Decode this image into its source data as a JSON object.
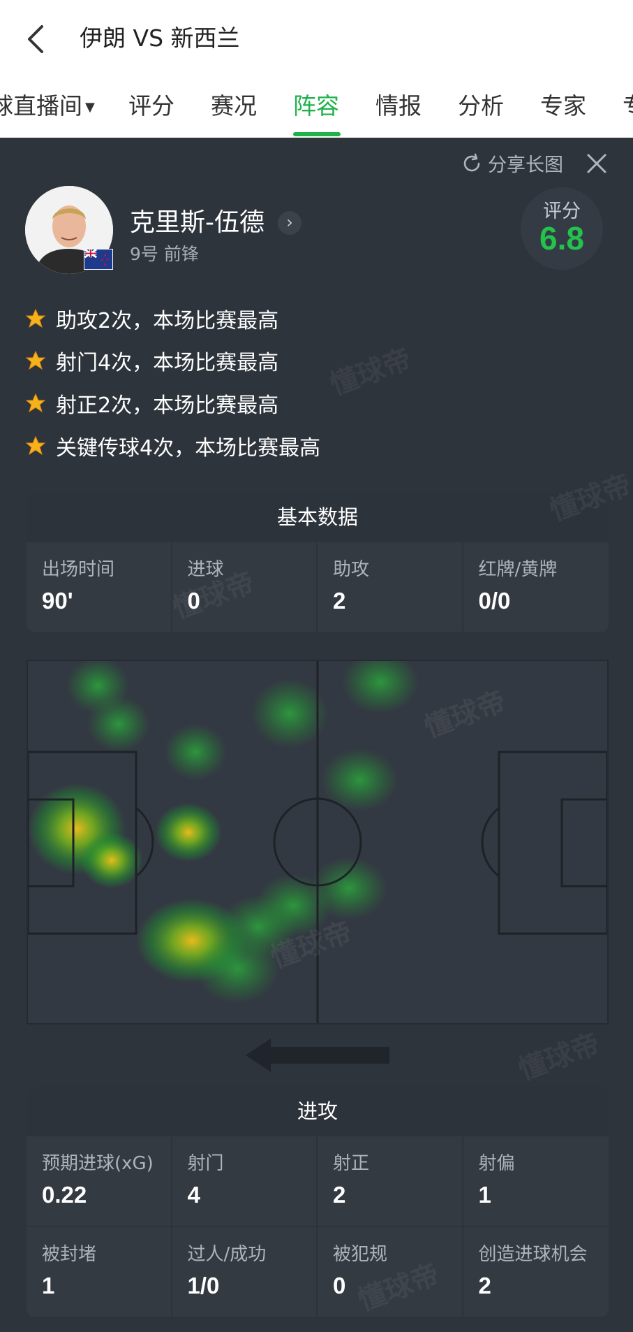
{
  "header": {
    "title": "伊朗 VS 新西兰"
  },
  "tabs": [
    {
      "label": "球直播间"
    },
    {
      "label": "评分"
    },
    {
      "label": "赛况"
    },
    {
      "label": "阵容"
    },
    {
      "label": "情报"
    },
    {
      "label": "分析"
    },
    {
      "label": "专家"
    },
    {
      "label": "专"
    }
  ],
  "share": {
    "label": "分享长图"
  },
  "player": {
    "name": "克里斯-伍德",
    "number_position": "9号 前锋",
    "rating_label": "评分",
    "rating": "6.8"
  },
  "highlights": [
    "助攻2次，本场比赛最高",
    "射门4次，本场比赛最高",
    "射正2次，本场比赛最高",
    "关键传球4次，本场比赛最高"
  ],
  "basic": {
    "title": "基本数据",
    "stats": [
      {
        "label": "出场时间",
        "value": "90'"
      },
      {
        "label": "进球",
        "value": "0"
      },
      {
        "label": "助攻",
        "value": "2"
      },
      {
        "label": "红牌/黄牌",
        "value": "0/0"
      }
    ]
  },
  "attack": {
    "title": "进攻",
    "stats": [
      {
        "label": "预期进球(xG)",
        "value": "0.22"
      },
      {
        "label": "射门",
        "value": "4"
      },
      {
        "label": "射正",
        "value": "2"
      },
      {
        "label": "射偏",
        "value": "1"
      },
      {
        "label": "被封堵",
        "value": "1"
      },
      {
        "label": "过人/成功",
        "value": "1/0"
      },
      {
        "label": "被犯规",
        "value": "0"
      },
      {
        "label": "创造进球机会",
        "value": "2"
      }
    ]
  },
  "watermark": "懂球帝",
  "colors": {
    "accent": "#1fb24a",
    "rating": "#22c24c",
    "background": "#2e343c"
  }
}
